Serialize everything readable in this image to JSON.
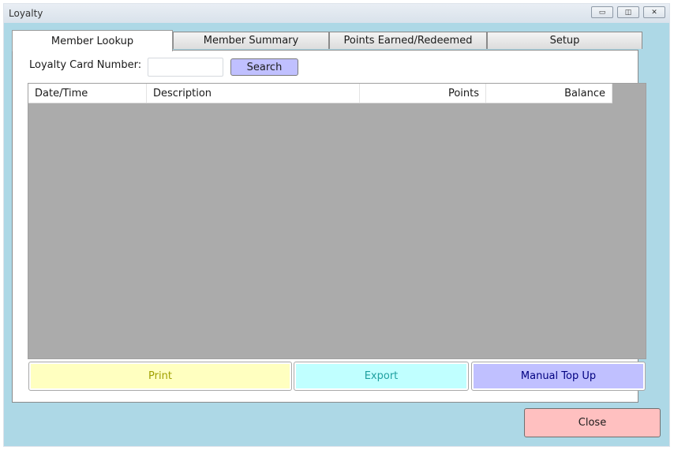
{
  "window": {
    "title": "Loyalty",
    "controls": {
      "minimize": "▭",
      "restore": "◫",
      "close": "✕"
    }
  },
  "tabs": [
    {
      "label": "Member Lookup",
      "active": true
    },
    {
      "label": "Member Summary",
      "active": false
    },
    {
      "label": "Points Earned/Redeemed",
      "active": false
    },
    {
      "label": "Setup",
      "active": false
    }
  ],
  "lookup": {
    "card_label": "Loyalty Card Number:",
    "card_value": "",
    "search_label": "Search"
  },
  "table": {
    "columns": [
      "Date/Time",
      "Description",
      "Points",
      "Balance"
    ],
    "rows": []
  },
  "actions": {
    "print": "Print",
    "export": "Export",
    "manual_top_up": "Manual Top Up"
  },
  "footer": {
    "close": "Close"
  },
  "colors": {
    "window_bg": "#add8e6",
    "print_bg": "#ffffc0",
    "print_text": "#a0a000",
    "export_bg": "#c0ffff",
    "export_text": "#20a0a0",
    "topup_bg": "#c0c0ff",
    "topup_text": "#000080",
    "close_bg": "#ffc0c0",
    "search_bg": "#c0c0ff",
    "grid_bg": "#ababab"
  }
}
